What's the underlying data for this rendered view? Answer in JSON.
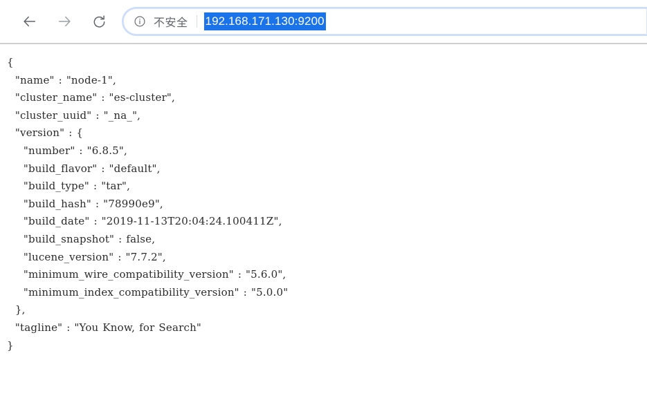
{
  "browser": {
    "back_label": "Back",
    "forward_label": "Forward",
    "reload_label": "Reload",
    "security_label": "不安全",
    "url": "192.168.171.130:9200",
    "url_selected": true,
    "icons": {
      "back": "arrow-left-icon",
      "forward": "arrow-right-icon",
      "reload": "reload-icon",
      "security": "info-circle-icon"
    },
    "colors": {
      "selection_background": "#1a73e8",
      "selection_text": "#ffffff",
      "focus_ring": "#8ab4f8",
      "chrome_text": "#5f6368",
      "divider": "#cfcfcf"
    }
  },
  "response": {
    "content_type": "json",
    "body": {
      "name": "node-1",
      "cluster_name": "es-cluster",
      "cluster_uuid": "_na_",
      "version": {
        "number": "6.8.5",
        "build_flavor": "default",
        "build_type": "tar",
        "build_hash": "78990e9",
        "build_date": "2019-11-13T20:04:24.100411Z",
        "build_snapshot": false,
        "lucene_version": "7.7.2",
        "minimum_wire_compatibility_version": "5.6.0",
        "minimum_index_compatibility_version": "5.0.0"
      },
      "tagline": "You Know, for Search"
    },
    "raw_text": "{\n  \"name\" : \"node-1\",\n  \"cluster_name\" : \"es-cluster\",\n  \"cluster_uuid\" : \"_na_\",\n  \"version\" : {\n    \"number\" : \"6.8.5\",\n    \"build_flavor\" : \"default\",\n    \"build_type\" : \"tar\",\n    \"build_hash\" : \"78990e9\",\n    \"build_date\" : \"2019-11-13T20:04:24.100411Z\",\n    \"build_snapshot\" : false,\n    \"lucene_version\" : \"7.7.2\",\n    \"minimum_wire_compatibility_version\" : \"5.6.0\",\n    \"minimum_index_compatibility_version\" : \"5.0.0\"\n  },\n  \"tagline\" : \"You Know, for Search\"\n}"
  }
}
